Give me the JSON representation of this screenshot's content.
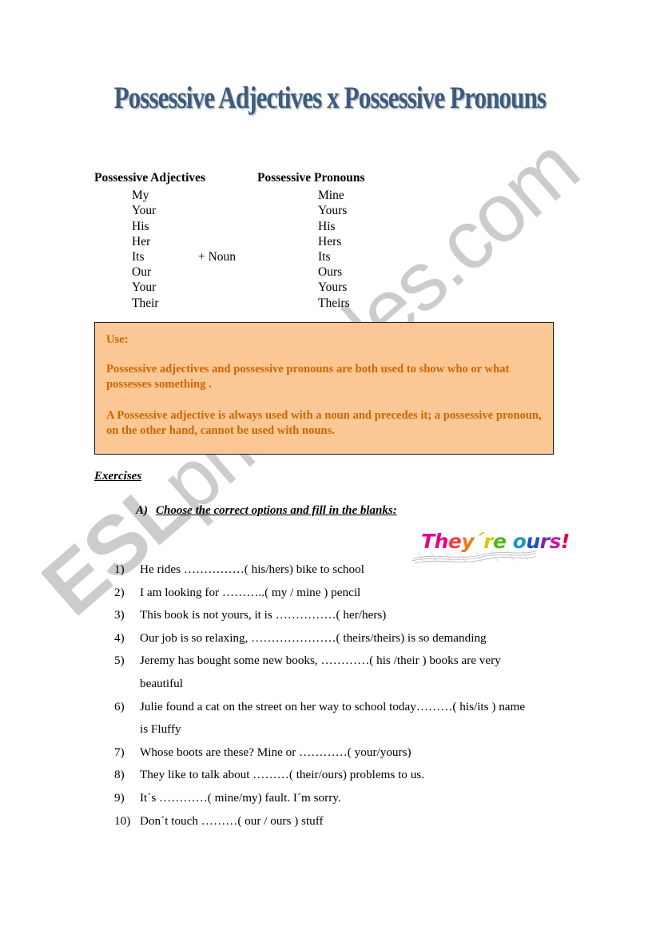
{
  "page": {
    "title": "Possessive Adjectives x Possessive Pronouns",
    "background_color": "#ffffff"
  },
  "watermark": {
    "bold_part": "ESL",
    "rest_part": "printables.com",
    "color": "#cccccc"
  },
  "pronoun_table": {
    "header_adjectives": "Possessive Adjectives",
    "header_pronouns": "Possessive Pronouns",
    "middle_note": "+ Noun",
    "rows": [
      {
        "adjective": "My",
        "pronoun": "Mine",
        "middle": ""
      },
      {
        "adjective": "Your",
        "pronoun": "Yours",
        "middle": ""
      },
      {
        "adjective": "His",
        "pronoun": "His",
        "middle": ""
      },
      {
        "adjective": "Her",
        "pronoun": "Hers",
        "middle": ""
      },
      {
        "adjective": "Its",
        "pronoun": "Its",
        "middle": "+ Noun"
      },
      {
        "adjective": "Our",
        "pronoun": "Ours",
        "middle": ""
      },
      {
        "adjective": "Your",
        "pronoun": "Yours",
        "middle": ""
      },
      {
        "adjective": "Their",
        "pronoun": "Theirs",
        "middle": ""
      }
    ]
  },
  "use_box": {
    "label": "Use:",
    "paragraph_1": "Possessive adjectives and possessive pronouns are both used to show who or what possesses something .",
    "paragraph_2": "A Possessive adjective is always used with a noun and precedes it;  a possessive pronoun, on the other hand, cannot be used with nouns.",
    "background_color": "#fac795",
    "border_color": "#1a1a1a",
    "text_color": "#cc6600"
  },
  "exercises": {
    "heading": "Exercises",
    "section_a_letter": "A)",
    "section_a_title": "Choose the correct options and fill in the blanks:"
  },
  "wordart": {
    "text": "They´re ours!",
    "letters": [
      {
        "char": "T",
        "color": "#e8008c"
      },
      {
        "char": "h",
        "color": "#e8008c"
      },
      {
        "char": "e",
        "color": "#f04040"
      },
      {
        "char": "y",
        "color": "#f07818"
      },
      {
        "char": "´",
        "color": "#e8c000"
      },
      {
        "char": "r",
        "color": "#c8d400"
      },
      {
        "char": "e",
        "color": "#4cb820"
      },
      {
        "char": " ",
        "color": "#4cb820"
      },
      {
        "char": "o",
        "color": "#1898c8"
      },
      {
        "char": "u",
        "color": "#2050c8"
      },
      {
        "char": "r",
        "color": "#7828c0"
      },
      {
        "char": "s",
        "color": "#c818a8"
      },
      {
        "char": "!",
        "color": "#e8003c"
      }
    ]
  },
  "questions": [
    {
      "number": "1)",
      "text": "He rides ……………( his/hers) bike to school",
      "continuation": ""
    },
    {
      "number": "2)",
      "text": "I am looking for ………..(  my / mine ) pencil",
      "continuation": ""
    },
    {
      "number": "3)",
      "text": "This book is not yours, it is ……………( her/hers)",
      "continuation": ""
    },
    {
      "number": "4)",
      "text": "Our job is so relaxing, …………………( theirs/theirs) is so demanding",
      "continuation": ""
    },
    {
      "number": "5)",
      "text": "Jeremy has bought some new books, …………( his /their ) books are very",
      "continuation": "beautiful"
    },
    {
      "number": "6)",
      "text": "Julie found a cat on the street on her way to school today………( his/its )  name",
      "continuation": "is Fluffy"
    },
    {
      "number": "7)",
      "text": "Whose boots are these? Mine or …………( your/yours)",
      "continuation": ""
    },
    {
      "number": "8)",
      "text": "They like to talk about ………( their/ours) problems to us.",
      "continuation": ""
    },
    {
      "number": "9)",
      "text": "It´s …………( mine/my) fault. I´m sorry.",
      "continuation": ""
    },
    {
      "number": "10)",
      "text": "Don´t touch ………( our / ours ) stuff",
      "continuation": ""
    }
  ]
}
